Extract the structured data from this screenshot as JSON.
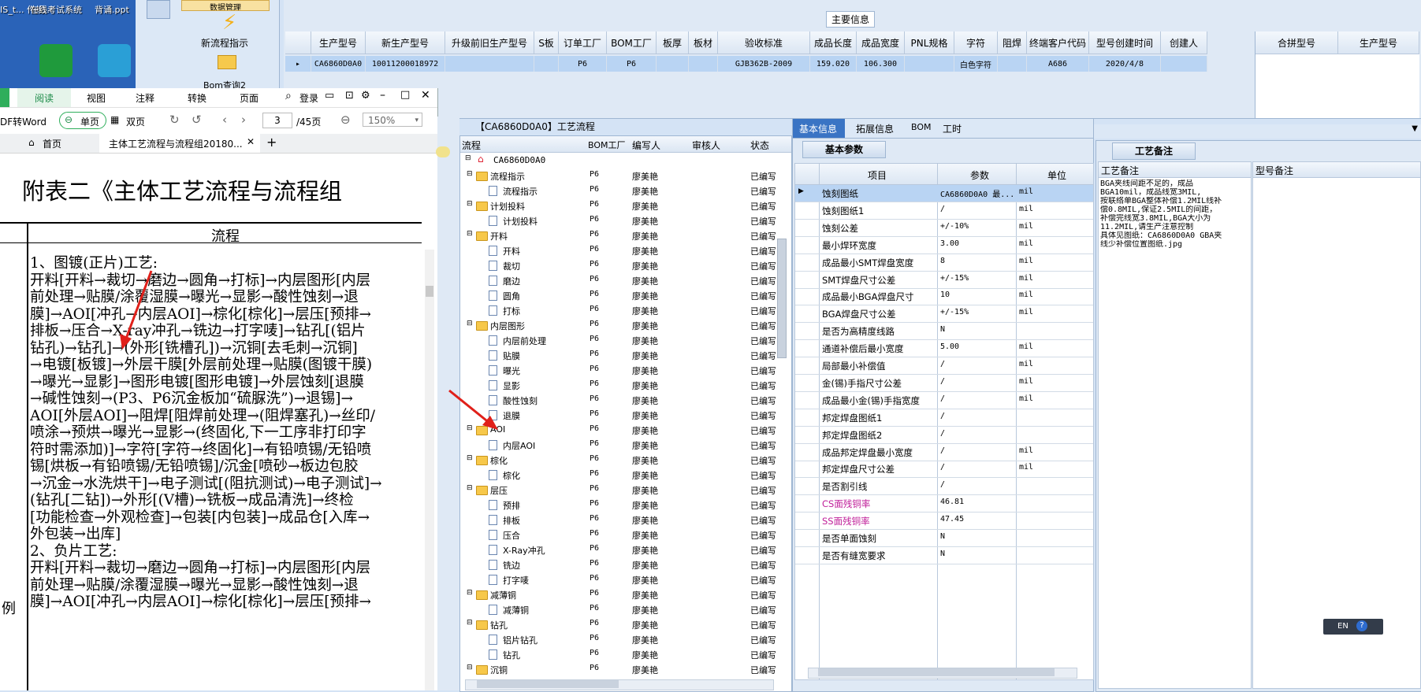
{
  "desktop": {
    "icons": [
      {
        "label": "IS_t... 作规..."
      },
      {
        "label": "在线考试系统"
      },
      {
        "label": "背诵.ppt"
      }
    ]
  },
  "nav": {
    "top_label": "数据管理",
    "new_flow_label": "新流程指示",
    "bom_label": "Bom查询2"
  },
  "main_info": {
    "title": "主要信息",
    "columns": [
      "生产型号",
      "新生产型号",
      "升级前旧生产型号",
      "S板",
      "订单工厂",
      "BOM工厂",
      "板厚",
      "板材",
      "验收标准",
      "成品长度",
      "成品宽度",
      "PNL规格",
      "字符",
      "阻焊",
      "终端客户代码",
      "型号创建时间",
      "创建人"
    ],
    "row": [
      "CA6860D0A0",
      "10011200018972",
      "",
      "",
      "P6",
      "P6",
      "",
      "",
      "GJB362B-2009",
      "159.020",
      "106.300",
      "",
      "白色字符",
      "",
      "A686",
      "2020/4/8",
      ""
    ],
    "right_columns": [
      "合拼型号",
      "生产型号"
    ]
  },
  "doc": {
    "tabs": [
      "阅读",
      "视图",
      "注释",
      "转换",
      "页面"
    ],
    "login_label": "登录",
    "pdf_to_word": "DF转Word",
    "single_page": "单页",
    "double_page": "双页",
    "page_current": "3",
    "page_total": "/45页",
    "zoom": "150%",
    "home_tab": "首页",
    "doc_tab": "主体工艺流程与流程组20180...",
    "heading": "附表二《主体工艺流程与流程组",
    "column_header": "流程",
    "left_fragment": "例",
    "lines": [
      "1、图镀(正片)工艺:",
      "开料[开料→裁切→磨边→圆角→打标]→内层图形[内层",
      "前处理→贴膜/涂覆湿膜→曝光→显影→酸性蚀刻→退",
      "膜]→AOI[冲孔→内层AOI]→棕化[棕化]→层压[预排→",
      "排板→压合→X-ray冲孔→铣边→打字唛]→钻孔[(铝片",
      "钻孔)→钻孔]→(外形[铣槽孔])→沉铜[去毛刺→沉铜]",
      "→电镀[板镀]→外层干膜[外层前处理→贴膜(图镀干膜)",
      "→曝光→显影]→图形电镀[图形电镀]→外层蚀刻[退膜",
      "→碱性蚀刻→(P3、P6沉金板加“硫脲洗”)→退锡]→",
      "AOI[外层AOI]→阻焊[阻焊前处理→(阻焊塞孔)→丝印/",
      "喷涂→预烘→曝光→显影→(终固化,下一工序非打印字",
      "符时需添加)]→字符[字符→终固化]→有铅喷锡/无铅喷",
      "锡[烘板→有铅喷锡/无铅喷锡]/沉金[喷砂→板边包胶",
      "→沉金→水洗烘干]→电子测试[(阻抗测试)→电子测试]→",
      "(钻孔[二钻])→外形[(V槽)→铣板→成品清洗]→终检",
      "[功能检查→外观检查]→包装[内包装]→成品仓[入库→",
      "外包装→出库]",
      "2、负片工艺:",
      "开料[开料→裁切→磨边→圆角→打标]→内层图形[内层",
      "前处理→贴膜/涂覆湿膜→曝光→显影→酸性蚀刻→退",
      "膜]→AOI[冲孔→内层AOI]→棕化[棕化]→层压[预排→"
    ]
  },
  "tree": {
    "title": "【CA6860D0A0】工艺流程",
    "columns": [
      "流程",
      "BOM工厂",
      "编写人",
      "审核人",
      "状态"
    ],
    "root": "CA6860D0A0",
    "rows": [
      {
        "name": "流程指示",
        "level": 1,
        "bom": "P6",
        "author": "廖美艳",
        "status": "已编写"
      },
      {
        "name": "流程指示",
        "level": 2,
        "bom": "P6",
        "author": "廖美艳",
        "status": "已编写"
      },
      {
        "name": "计划投料",
        "level": 1,
        "bom": "P6",
        "author": "廖美艳",
        "status": "已编写"
      },
      {
        "name": "计划投料",
        "level": 2,
        "bom": "P6",
        "author": "廖美艳",
        "status": "已编写"
      },
      {
        "name": "开料",
        "level": 1,
        "bom": "P6",
        "author": "廖美艳",
        "status": "已编写"
      },
      {
        "name": "开料",
        "level": 2,
        "bom": "P6",
        "author": "廖美艳",
        "status": "已编写"
      },
      {
        "name": "裁切",
        "level": 2,
        "bom": "P6",
        "author": "廖美艳",
        "status": "已编写"
      },
      {
        "name": "磨边",
        "level": 2,
        "bom": "P6",
        "author": "廖美艳",
        "status": "已编写"
      },
      {
        "name": "圆角",
        "level": 2,
        "bom": "P6",
        "author": "廖美艳",
        "status": "已编写"
      },
      {
        "name": "打标",
        "level": 2,
        "bom": "P6",
        "author": "廖美艳",
        "status": "已编写"
      },
      {
        "name": "内层图形",
        "level": 1,
        "bom": "P6",
        "author": "廖美艳",
        "status": "已编写"
      },
      {
        "name": "内层前处理",
        "level": 2,
        "bom": "P6",
        "author": "廖美艳",
        "status": "已编写"
      },
      {
        "name": "贴膜",
        "level": 2,
        "bom": "P6",
        "author": "廖美艳",
        "status": "已编写"
      },
      {
        "name": "曝光",
        "level": 2,
        "bom": "P6",
        "author": "廖美艳",
        "status": "已编写"
      },
      {
        "name": "显影",
        "level": 2,
        "bom": "P6",
        "author": "廖美艳",
        "status": "已编写"
      },
      {
        "name": "酸性蚀刻",
        "level": 2,
        "bom": "P6",
        "author": "廖美艳",
        "status": "已编写"
      },
      {
        "name": "退膜",
        "level": 2,
        "bom": "P6",
        "author": "廖美艳",
        "status": "已编写"
      },
      {
        "name": "AOI",
        "level": 1,
        "bom": "P6",
        "author": "廖美艳",
        "status": "已编写"
      },
      {
        "name": "内层AOI",
        "level": 2,
        "bom": "P6",
        "author": "廖美艳",
        "status": "已编写"
      },
      {
        "name": "棕化",
        "level": 1,
        "bom": "P6",
        "author": "廖美艳",
        "status": "已编写"
      },
      {
        "name": "棕化",
        "level": 2,
        "bom": "P6",
        "author": "廖美艳",
        "status": "已编写"
      },
      {
        "name": "层压",
        "level": 1,
        "bom": "P6",
        "author": "廖美艳",
        "status": "已编写"
      },
      {
        "name": "预排",
        "level": 2,
        "bom": "P6",
        "author": "廖美艳",
        "status": "已编写"
      },
      {
        "name": "排板",
        "level": 2,
        "bom": "P6",
        "author": "廖美艳",
        "status": "已编写"
      },
      {
        "name": "压合",
        "level": 2,
        "bom": "P6",
        "author": "廖美艳",
        "status": "已编写"
      },
      {
        "name": "X-Ray冲孔",
        "level": 2,
        "bom": "P6",
        "author": "廖美艳",
        "status": "已编写"
      },
      {
        "name": "铣边",
        "level": 2,
        "bom": "P6",
        "author": "廖美艳",
        "status": "已编写"
      },
      {
        "name": "打字唛",
        "level": 2,
        "bom": "P6",
        "author": "廖美艳",
        "status": "已编写"
      },
      {
        "name": "减薄铜",
        "level": 1,
        "bom": "P6",
        "author": "廖美艳",
        "status": "已编写"
      },
      {
        "name": "减薄铜",
        "level": 2,
        "bom": "P6",
        "author": "廖美艳",
        "status": "已编写"
      },
      {
        "name": "钻孔",
        "level": 1,
        "bom": "P6",
        "author": "廖美艳",
        "status": "已编写"
      },
      {
        "name": "铝片钻孔",
        "level": 2,
        "bom": "P6",
        "author": "廖美艳",
        "status": "已编写"
      },
      {
        "name": "钻孔",
        "level": 2,
        "bom": "P6",
        "author": "廖美艳",
        "status": "已编写"
      },
      {
        "name": "沉铜",
        "level": 1,
        "bom": "P6",
        "author": "廖美艳",
        "status": "已编写"
      }
    ]
  },
  "basic": {
    "tabs": [
      "基本信息",
      "拓展信息",
      "BOM",
      "工时"
    ],
    "sub_tab": "基本参数",
    "columns": [
      "项目",
      "参数",
      "单位"
    ],
    "rows": [
      {
        "item": "蚀刻图纸",
        "value": "CA6860D0A0 最...",
        "unit": "mil"
      },
      {
        "item": "蚀刻图纸1",
        "value": "/",
        "unit": "mil"
      },
      {
        "item": "蚀刻公差",
        "value": "+/-10%",
        "unit": "mil"
      },
      {
        "item": "最小焊环宽度",
        "value": "3.00",
        "unit": "mil"
      },
      {
        "item": "成品最小SMT焊盘宽度",
        "value": "8",
        "unit": "mil"
      },
      {
        "item": "SMT焊盘尺寸公差",
        "value": "+/-15%",
        "unit": "mil"
      },
      {
        "item": "成品最小BGA焊盘尺寸",
        "value": "10",
        "unit": "mil"
      },
      {
        "item": "BGA焊盘尺寸公差",
        "value": "+/-15%",
        "unit": "mil"
      },
      {
        "item": "是否为高精度线路",
        "value": "N",
        "unit": ""
      },
      {
        "item": "通道补偿后最小宽度",
        "value": "5.00",
        "unit": "mil"
      },
      {
        "item": "局部最小补偿值",
        "value": "/",
        "unit": "mil"
      },
      {
        "item": "金(锡)手指尺寸公差",
        "value": "/",
        "unit": "mil"
      },
      {
        "item": "成品最小金(锡)手指宽度",
        "value": "/",
        "unit": "mil"
      },
      {
        "item": "邦定焊盘图纸1",
        "value": "/",
        "unit": ""
      },
      {
        "item": "邦定焊盘图纸2",
        "value": "/",
        "unit": ""
      },
      {
        "item": "成品邦定焊盘最小宽度",
        "value": "/",
        "unit": "mil"
      },
      {
        "item": "邦定焊盘尺寸公差",
        "value": "/",
        "unit": "mil"
      },
      {
        "item": "是否割引线",
        "value": "/",
        "unit": ""
      },
      {
        "item": "CS面残铜率",
        "value": "46.81",
        "unit": ""
      },
      {
        "item": "SS面残铜率",
        "value": "47.45",
        "unit": ""
      },
      {
        "item": "是否单面蚀刻",
        "value": "N",
        "unit": ""
      },
      {
        "item": "是否有缝宽要求",
        "value": "N",
        "unit": ""
      }
    ]
  },
  "remark": {
    "tab": "工艺备注",
    "col1": "工艺备注",
    "col2": "型号备注",
    "lines": [
      "BGA夹线间距不足的，成品",
      "BGA10mil，成品线宽3MIL,",
      "按联络单BGA整体补偿1.2MIL线补",
      "偿0.8MIL,保证2.5MIL的间距，",
      "补偿完线宽3.8MIL,BGA大小为",
      "11.2MIL,请生产注意控制",
      "具体见图纸：CA6860D0A0 GBA夹",
      "线少补偿位置图纸.jpg"
    ]
  },
  "ime": {
    "label": "EN"
  },
  "colors": {
    "accent": "#3a74c4",
    "selected_row": "#b9d4f3",
    "red_item": "#c0209a",
    "arrow": "#e0201a"
  }
}
